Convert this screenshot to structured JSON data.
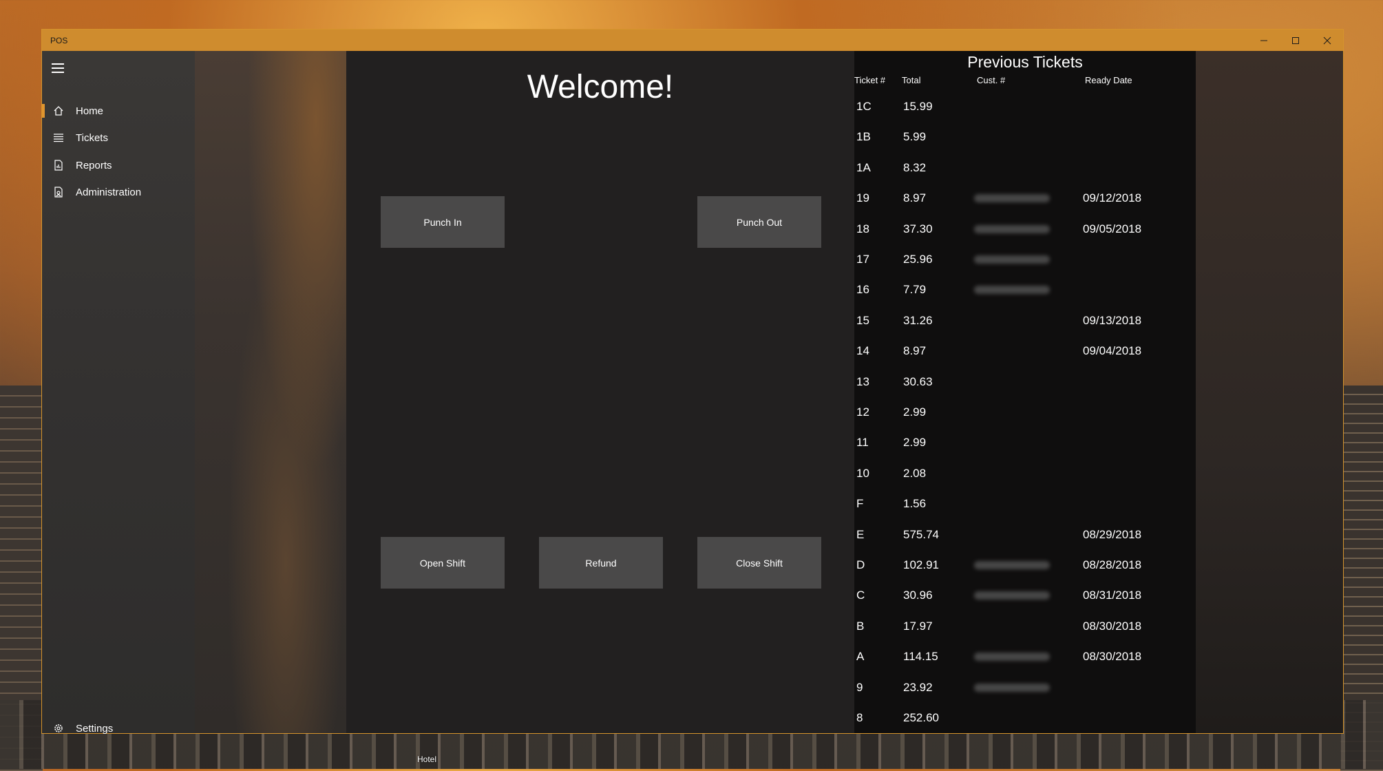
{
  "window": {
    "title": "POS",
    "controls": [
      "minimize",
      "maximize",
      "close"
    ]
  },
  "nav": {
    "items": [
      {
        "label": "Home",
        "icon": "home-icon",
        "active": true
      },
      {
        "label": "Tickets",
        "icon": "list-icon",
        "active": false
      },
      {
        "label": "Reports",
        "icon": "report-icon",
        "active": false
      },
      {
        "label": "Administration",
        "icon": "admin-icon",
        "active": false
      }
    ],
    "settings": {
      "label": "Settings",
      "icon": "gear-icon"
    }
  },
  "main": {
    "welcome": "Welcome!",
    "punch_in": "Punch In",
    "punch_out": "Punch Out",
    "open_shift": "Open Shift",
    "refund": "Refund",
    "close_shift": "Close Shift"
  },
  "tickets": {
    "title": "Previous Tickets",
    "columns": [
      "Ticket #",
      "Total",
      "Cust. #",
      "Ready Date"
    ],
    "rows": [
      {
        "ticket": "1C",
        "total": "15.99",
        "customer_blurred": false,
        "ready": ""
      },
      {
        "ticket": "1B",
        "total": "5.99",
        "customer_blurred": false,
        "ready": ""
      },
      {
        "ticket": "1A",
        "total": "8.32",
        "customer_blurred": false,
        "ready": ""
      },
      {
        "ticket": "19",
        "total": "8.97",
        "customer_blurred": true,
        "ready": "09/12/2018"
      },
      {
        "ticket": "18",
        "total": "37.30",
        "customer_blurred": true,
        "ready": "09/05/2018"
      },
      {
        "ticket": "17",
        "total": "25.96",
        "customer_blurred": true,
        "ready": ""
      },
      {
        "ticket": "16",
        "total": "7.79",
        "customer_blurred": true,
        "ready": ""
      },
      {
        "ticket": "15",
        "total": "31.26",
        "customer_blurred": false,
        "ready": "09/13/2018"
      },
      {
        "ticket": "14",
        "total": "8.97",
        "customer_blurred": false,
        "ready": "09/04/2018"
      },
      {
        "ticket": "13",
        "total": "30.63",
        "customer_blurred": false,
        "ready": ""
      },
      {
        "ticket": "12",
        "total": "2.99",
        "customer_blurred": false,
        "ready": ""
      },
      {
        "ticket": "11",
        "total": "2.99",
        "customer_blurred": false,
        "ready": ""
      },
      {
        "ticket": "10",
        "total": "2.08",
        "customer_blurred": false,
        "ready": ""
      },
      {
        "ticket": "F",
        "total": "1.56",
        "customer_blurred": false,
        "ready": ""
      },
      {
        "ticket": "E",
        "total": "575.74",
        "customer_blurred": false,
        "ready": "08/29/2018"
      },
      {
        "ticket": "D",
        "total": "102.91",
        "customer_blurred": true,
        "ready": "08/28/2018"
      },
      {
        "ticket": "C",
        "total": "30.96",
        "customer_blurred": true,
        "ready": "08/31/2018"
      },
      {
        "ticket": "B",
        "total": "17.97",
        "customer_blurred": false,
        "ready": "08/30/2018"
      },
      {
        "ticket": "A",
        "total": "114.15",
        "customer_blurred": true,
        "ready": "08/30/2018"
      },
      {
        "ticket": "9",
        "total": "23.92",
        "customer_blurred": true,
        "ready": ""
      },
      {
        "ticket": "8",
        "total": "252.60",
        "customer_blurred": false,
        "ready": ""
      }
    ]
  },
  "desktop": {
    "icon_label": "Hotel"
  },
  "colors": {
    "accent": "#cf8c2e",
    "button": "#4a4949",
    "panel": "#0f0e0e"
  }
}
